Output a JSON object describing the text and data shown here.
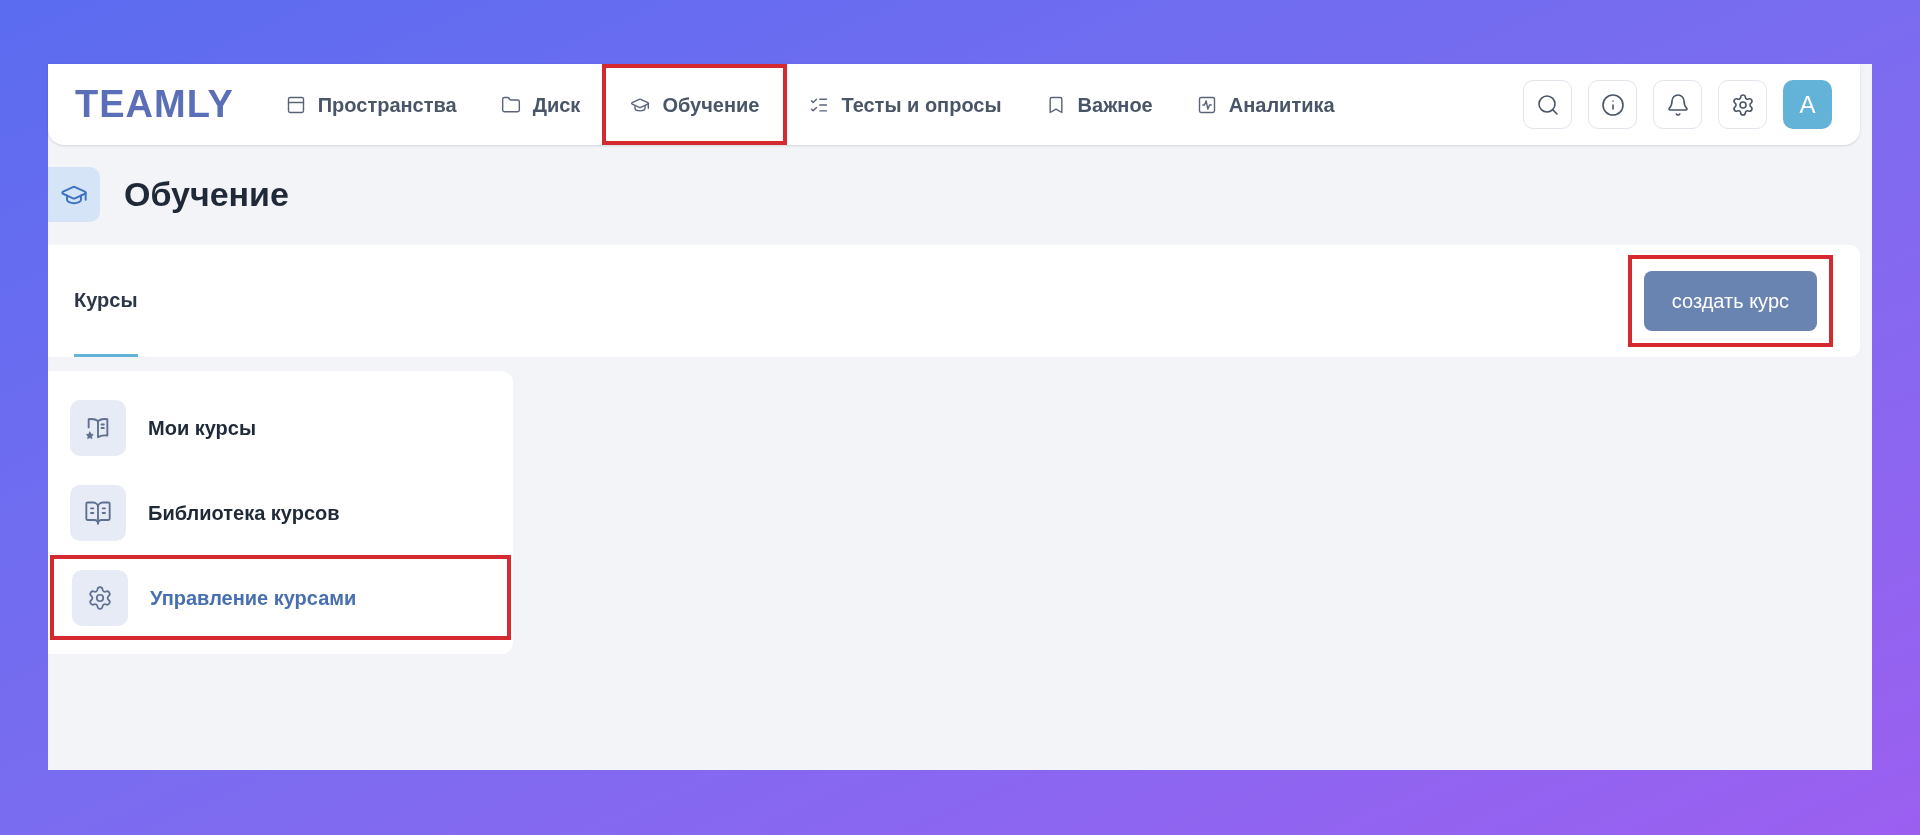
{
  "logo": "TEAMLY",
  "nav": [
    {
      "label": "Пространства",
      "highlighted": false
    },
    {
      "label": "Диск",
      "highlighted": false
    },
    {
      "label": "Обучение",
      "highlighted": true
    },
    {
      "label": "Тесты и опросы",
      "highlighted": false
    },
    {
      "label": "Важное",
      "highlighted": false
    },
    {
      "label": "Аналитика",
      "highlighted": false
    }
  ],
  "avatar": "A",
  "page_title": "Обучение",
  "tabs": [
    {
      "label": "Курсы",
      "selected": true
    }
  ],
  "create_button": {
    "label": "создать курс",
    "highlighted": true
  },
  "sidebar": {
    "items": [
      {
        "label": "Мои курсы",
        "selected": false,
        "highlighted": false
      },
      {
        "label": "Библиотека курсов",
        "selected": false,
        "highlighted": false
      },
      {
        "label": "Управление курсами",
        "selected": true,
        "highlighted": true
      }
    ]
  }
}
